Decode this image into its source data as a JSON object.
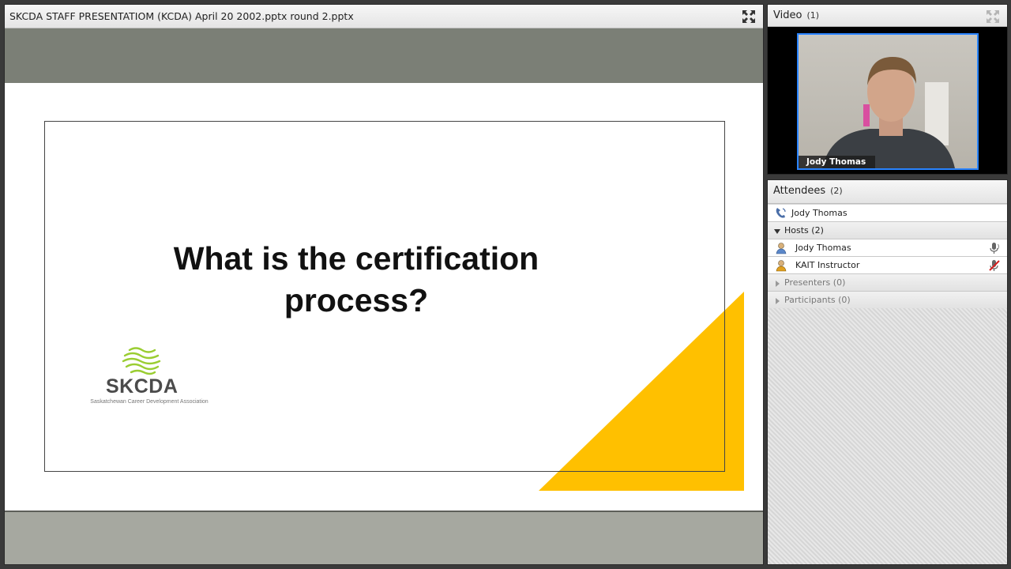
{
  "share_pod": {
    "title": "SKCDA STAFF PRESENTATIOM (KCDA) April 20 2002.pptx round 2.pptx",
    "fullscreen_icon": "expand-arrows-icon"
  },
  "slide": {
    "title": "What is the certification process?",
    "logo_text": "SKCDA",
    "logo_subtitle": "Saskatchewan Career Development Association",
    "accent_color": "#FFC000",
    "logo_color": "#9ACD32"
  },
  "video_pod": {
    "title": "Video",
    "count": "(1)",
    "participant_name": "Jody Thomas",
    "highlight_color": "#2A84FF"
  },
  "attendees_pod": {
    "title": "Attendees",
    "count": "(2)",
    "phone_user": "Jody Thomas",
    "hosts_label": "Hosts (2)",
    "hosts": [
      {
        "name": "Jody Thomas",
        "status_icon": "microphone-active-icon"
      },
      {
        "name": "KAIT Instructor",
        "status_icon": "microphone-muted-icon"
      }
    ],
    "presenters_label": "Presenters (0)",
    "participants_label": "Participants (0)"
  }
}
